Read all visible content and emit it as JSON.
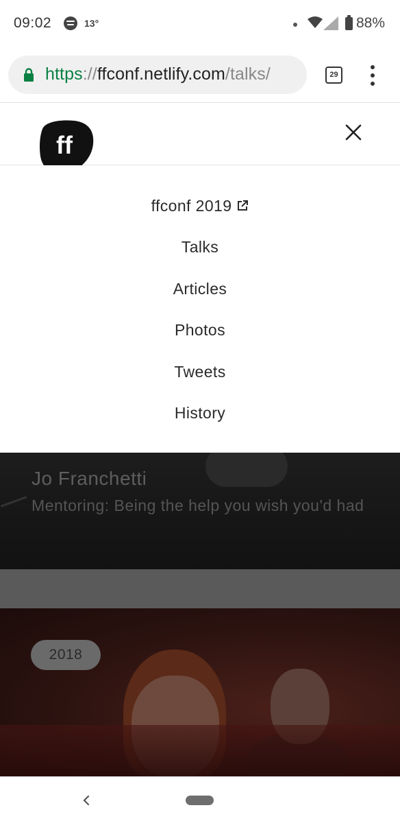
{
  "status_bar": {
    "time": "09:02",
    "temperature": "13°",
    "battery": "88%",
    "icons": [
      "spotify-icon",
      "notification-dot",
      "wifi-icon",
      "signal-icon",
      "battery-icon"
    ]
  },
  "browser": {
    "url_scheme": "https",
    "url_separator": "://",
    "url_host": "ffconf.netlify.com",
    "url_path": "/talks/",
    "tab_count": "29",
    "secure": true,
    "colors": {
      "secure": "#0b8043"
    }
  },
  "header": {
    "logo_text": "ff"
  },
  "nav": {
    "items": [
      {
        "label": "ffconf 2019",
        "external": true
      },
      {
        "label": "Talks"
      },
      {
        "label": "Articles"
      },
      {
        "label": "Photos"
      },
      {
        "label": "Tweets"
      },
      {
        "label": "History"
      }
    ]
  },
  "talk_card": {
    "speaker": "Jo Franchetti",
    "title": "Mentoring: Being the help you wish you'd had"
  },
  "photo_card": {
    "year": "2018"
  }
}
